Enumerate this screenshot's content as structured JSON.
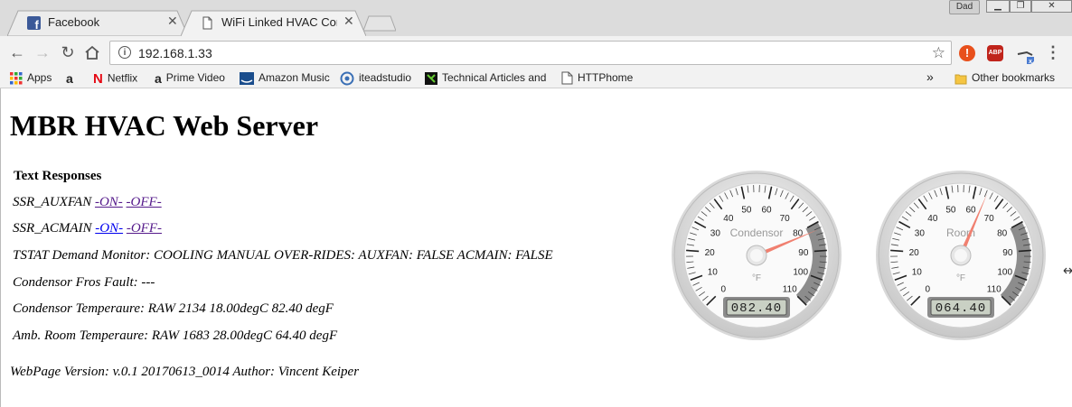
{
  "browser": {
    "tabs": [
      {
        "label": "Facebook",
        "icon": "facebook-icon",
        "active": false
      },
      {
        "label": "WiFi Linked HVAC Contro",
        "icon": "page-icon",
        "active": true
      }
    ],
    "user_badge": "Dad",
    "url": "192.168.1.33",
    "bookmarks": [
      {
        "label": "Apps",
        "icon": "apps-icon"
      },
      {
        "label": "",
        "icon": "amazon-icon"
      },
      {
        "label": "Netflix",
        "icon": "netflix-icon"
      },
      {
        "label": "Prime Video",
        "icon": "amazon-icon"
      },
      {
        "label": "Amazon Music",
        "icon": "amazon-music-icon"
      },
      {
        "label": "iteadstudio",
        "icon": "iteadstudio-icon"
      },
      {
        "label": "Technical Articles and",
        "icon": "technical-articles-icon"
      },
      {
        "label": "HTTPhome",
        "icon": "page-icon"
      }
    ],
    "overflow": "»",
    "other_bookmarks": "Other bookmarks"
  },
  "page": {
    "title": "MBR HVAC Web Server",
    "text_responses_heading": "Text Responses",
    "auxfan_label": "SSR_AUXFAN ",
    "acmain_label": "SSR_ACMAIN ",
    "on_link": "-ON-",
    "off_link": "-OFF-",
    "tstat_line": "TSTAT Demand Monitor: COOLING MANUAL OVER-RIDES: AUXFAN: FALSE ACMAIN: FALSE",
    "fault_line": "Condensor Fros Fault: ---",
    "condensor_line": "Condensor Temperaure: RAW 2134 18.00degC 82.40 degF",
    "room_line": "Amb. Room Temperaure: RAW 1683 28.00degC 64.40 degF",
    "version_line": "WebPage Version: v.0.1 20170613_0014 Author: Vincent Keiper"
  },
  "gauges": [
    {
      "label": "Condensor",
      "units": "°F",
      "value": 82.4,
      "display": "082.40",
      "min": 0,
      "max": 110,
      "major_ticks": [
        0,
        10,
        20,
        30,
        40,
        50,
        60,
        70,
        80,
        90,
        100,
        110
      ],
      "highlight_from": 80,
      "highlight_to": 110
    },
    {
      "label": "Room",
      "units": "°F",
      "value": 64.4,
      "display": "064.40",
      "min": 0,
      "max": 110,
      "major_ticks": [
        0,
        10,
        20,
        30,
        40,
        50,
        60,
        70,
        80,
        90,
        100,
        110
      ],
      "highlight_from": 80,
      "highlight_to": 110
    }
  ],
  "colors": {
    "facebook": "#3b5998",
    "link": "#551a8b",
    "link_unvisited": "#0000ee",
    "needle": "#f08070",
    "highlight_band": "#8c8c8c",
    "adblock": "#c0241b",
    "alert": "#e8501c"
  }
}
